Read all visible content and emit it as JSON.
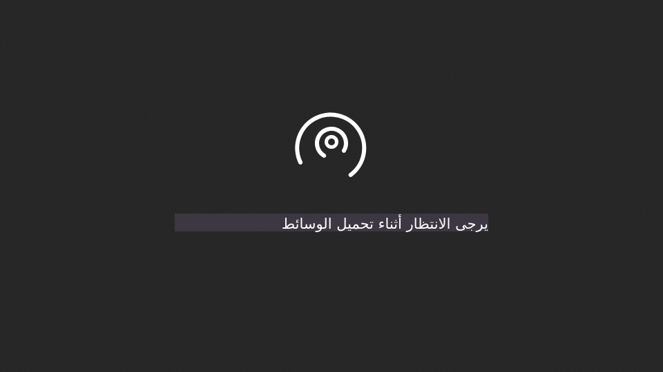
{
  "icon": "media-loading-icon",
  "colors": {
    "background": "#262626",
    "caption_highlight": "#3c3741",
    "foreground": "#ffffff"
  },
  "message": "يرجى الانتظار أثناء تحميل الوسائط"
}
